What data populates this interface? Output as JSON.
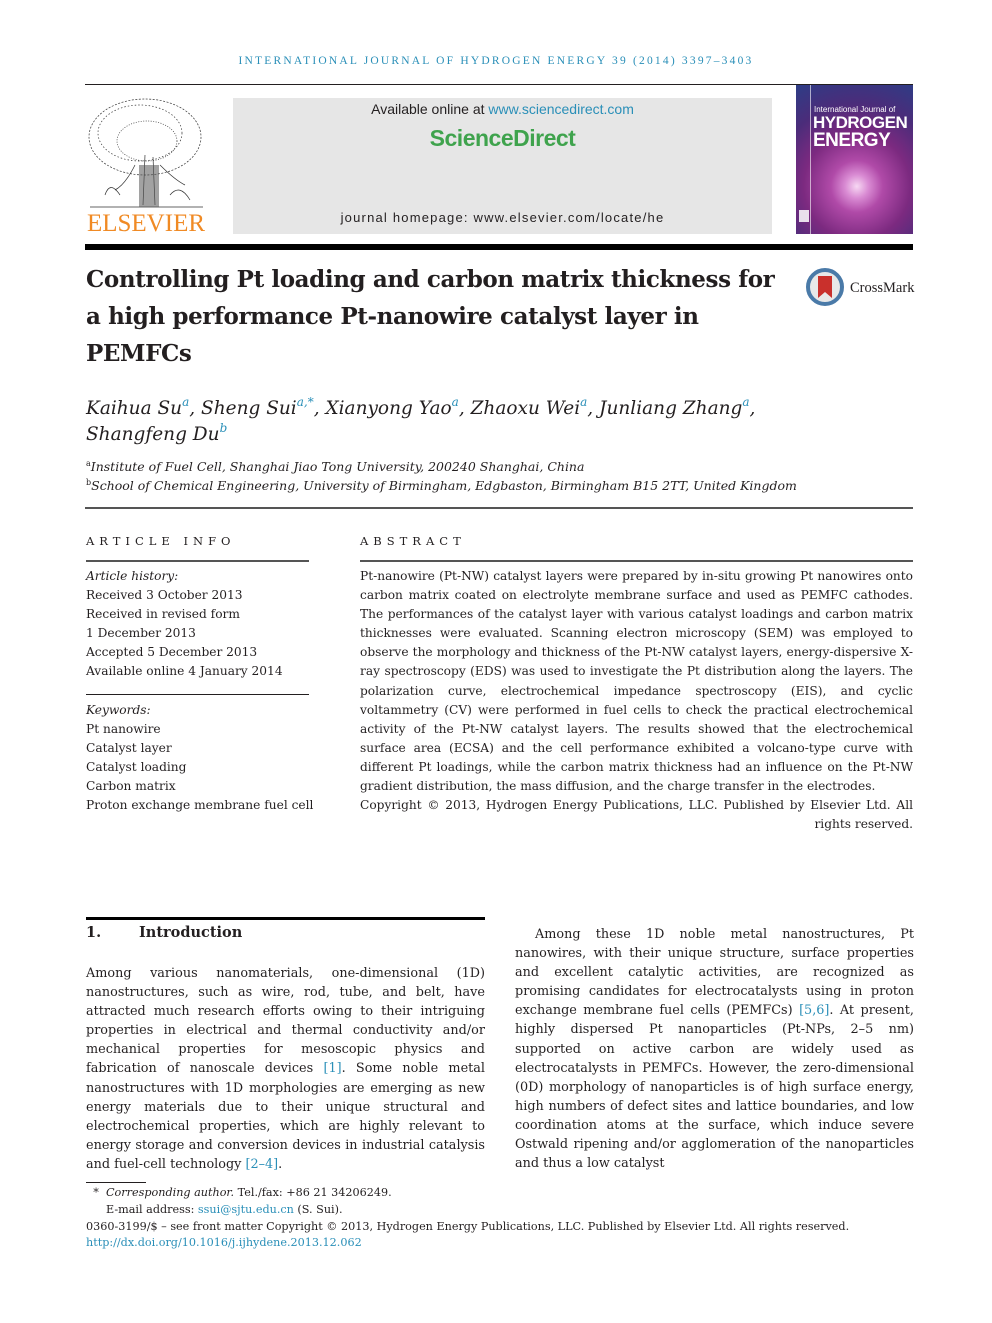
{
  "running_head": "International Journal of Hydrogen Energy 39 (2014) 3397–3403",
  "header": {
    "publisher_name": "ELSEVIER",
    "available_online_prefix": "Available online at ",
    "available_online_link": "www.sciencedirect.com",
    "brand": "ScienceDirect",
    "journal_homepage": "journal homepage: www.elsevier.com/locate/he",
    "cover": {
      "line1": "International Journal of",
      "line2": "HYDROGEN",
      "line3": "ENERGY"
    },
    "colors": {
      "link_blue": "#2a8fb8",
      "brand_green": "#3fa34d",
      "elsevier_orange": "#f08a24",
      "box_gray": "#e6e6e6"
    }
  },
  "article": {
    "title": "Controlling Pt loading and carbon matrix thickness for a high performance Pt-nanowire catalyst layer in PEMFCs",
    "crossmark_label": "CrossMark",
    "authors": [
      {
        "name": "Kaihua Su",
        "sup": "a"
      },
      {
        "name": "Sheng Sui",
        "sup": "a,*"
      },
      {
        "name": "Xianyong Yao",
        "sup": "a"
      },
      {
        "name": "Zhaoxu Wei",
        "sup": "a"
      },
      {
        "name": "Junliang Zhang",
        "sup": "a"
      },
      {
        "name": "Shangfeng Du",
        "sup": "b"
      }
    ],
    "affiliations": [
      {
        "key": "a",
        "text": "Institute of Fuel Cell, Shanghai Jiao Tong University, 200240 Shanghai, China"
      },
      {
        "key": "b",
        "text": "School of Chemical Engineering, University of Birmingham, Edgbaston, Birmingham B15 2TT, United Kingdom"
      }
    ]
  },
  "article_info": {
    "heading": "ARTICLE INFO",
    "history_label": "Article history:",
    "history": [
      "Received 3 October 2013",
      "Received in revised form",
      "1 December 2013",
      "Accepted 5 December 2013",
      "Available online 4 January 2014"
    ],
    "keywords_label": "Keywords:",
    "keywords": [
      "Pt nanowire",
      "Catalyst layer",
      "Catalyst loading",
      "Carbon matrix",
      "Proton exchange membrane fuel cell"
    ]
  },
  "abstract": {
    "heading": "ABSTRACT",
    "body": "Pt-nanowire (Pt-NW) catalyst layers were prepared by in-situ growing Pt nanowires onto carbon matrix coated on electrolyte membrane surface and used as PEMFC cathodes. The performances of the catalyst layer with various catalyst loadings and carbon matrix thicknesses were evaluated. Scanning electron microscopy (SEM) was employed to observe the morphology and thickness of the Pt-NW catalyst layers, energy-dispersive X-ray spectroscopy (EDS) was used to investigate the Pt distribution along the layers. The polarization curve, electrochemical impedance spectroscopy (EIS), and cyclic voltammetry (CV) were performed in fuel cells to check the practical electrochemical activity of the Pt-NW catalyst layers. The results showed that the electrochemical surface area (ECSA) and the cell performance exhibited a volcano-type curve with different Pt loadings, while the carbon matrix thickness had an influence on the Pt-NW gradient distribution, the mass diffusion, and the charge transfer in the electrodes.",
    "copyright": "Copyright © 2013, Hydrogen Energy Publications, LLC. Published by Elsevier Ltd. All rights reserved."
  },
  "introduction": {
    "number": "1.",
    "title": "Introduction",
    "left_p1": "Among various nanomaterials, one-dimensional (1D) nanostructures, such as wire, rod, tube, and belt, have attracted much research efforts owing to their intriguing properties in electrical and thermal conductivity and/or mechanical properties for mesoscopic physics and fabrication of nanoscale devices ",
    "left_ref1": "[1]",
    "left_p2": ". Some noble metal nanostructures with 1D morphologies are emerging as new energy materials due to their unique structural and electrochemical properties, which are highly relevant to energy storage and conversion devices in industrial catalysis and fuel-cell technology ",
    "left_ref2": "[2–4]",
    "left_p3": ".",
    "right_p1": "Among these 1D noble metal nanostructures, Pt nanowires, with their unique structure, surface properties and excellent catalytic activities, are recognized as promising candidates for electrocatalysts using in proton exchange membrane fuel cells (PEMFCs) ",
    "right_ref1": "[5,6]",
    "right_p2": ". At present, highly dispersed Pt nanoparticles (Pt-NPs, 2–5 nm) supported on active carbon are widely used as electrocatalysts in PEMFCs. However, the zero-dimensional (0D) morphology of nanoparticles is of high surface energy, high numbers of defect sites and lattice boundaries, and low coordination atoms at the surface, which induce severe Ostwald ripening and/or agglomeration of the nanoparticles and thus a low catalyst"
  },
  "footnotes": {
    "star": "*",
    "corresponding_label": "Corresponding author.",
    "tel": " Tel./fax: +86 21 34206249.",
    "email_label": "E-mail address: ",
    "email": "ssui@sjtu.edu.cn",
    "email_suffix": " (S. Sui).",
    "issn_line": "0360-3199/$ – see front matter Copyright © 2013, Hydrogen Energy Publications, LLC. Published by Elsevier Ltd. All rights reserved.",
    "doi": "http://dx.doi.org/10.1016/j.ijhydene.2013.12.062"
  }
}
